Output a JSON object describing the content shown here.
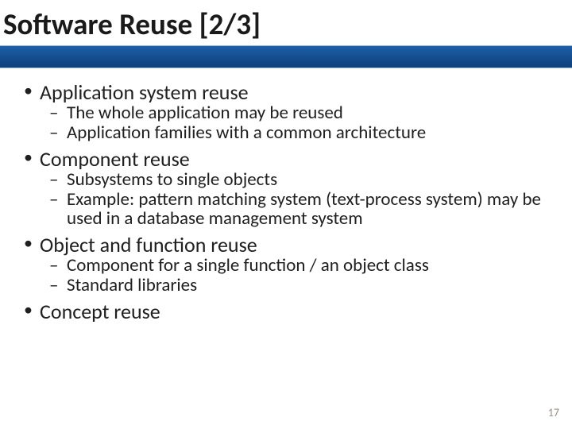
{
  "title": "Software Reuse [2/3]",
  "page_number": "17",
  "bullets": {
    "b1": "Application system reuse",
    "b1_1": "The whole application may be reused",
    "b1_2": "Application families with a common architecture",
    "b2": "Component reuse",
    "b2_1": "Subsystems to single objects",
    "b2_2": "Example: pattern matching system (text-process system) may be used in a database management system",
    "b3": "Object and function reuse",
    "b3_1": "Component for a single function / an object class",
    "b3_2": "Standard libraries",
    "b4": "Concept reuse"
  }
}
